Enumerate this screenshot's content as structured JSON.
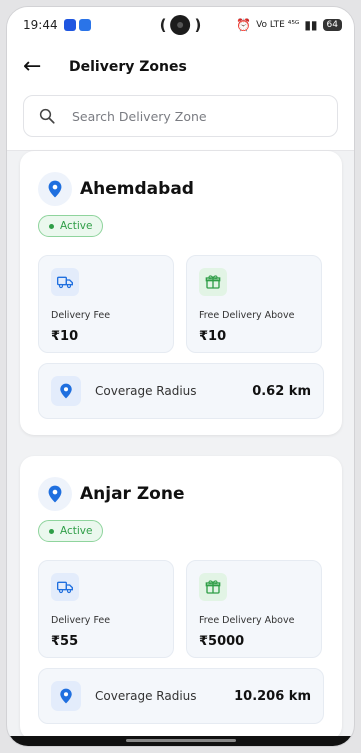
{
  "status_bar": {
    "time": "19:44",
    "center_left": "(",
    "center_right": ")",
    "signal_text": "Vo LTE  ⁴⁵ᴳ",
    "battery": "64"
  },
  "header": {
    "back_icon": "arrow-left-icon",
    "title": "Delivery Zones"
  },
  "search": {
    "icon": "search-icon",
    "placeholder": "Search Delivery Zone",
    "value": ""
  },
  "colors": {
    "accent_blue": "#1f6fdf",
    "status_green": "#2f9e47",
    "card_bg": "#ffffff",
    "tile_bg": "#f4f7fb"
  },
  "zones": [
    {
      "name": "Ahemdabad",
      "status": "Active",
      "delivery_fee_label": "Delivery Fee",
      "delivery_fee": "₹10",
      "free_delivery_label": "Free Delivery Above",
      "free_delivery": "₹10",
      "coverage_label": "Coverage Radius",
      "coverage_value": "0.62 km"
    },
    {
      "name": "Anjar Zone",
      "status": "Active",
      "delivery_fee_label": "Delivery Fee",
      "delivery_fee": "₹55",
      "free_delivery_label": "Free Delivery Above",
      "free_delivery": "₹5000",
      "coverage_label": "Coverage Radius",
      "coverage_value": "10.206 km"
    }
  ]
}
